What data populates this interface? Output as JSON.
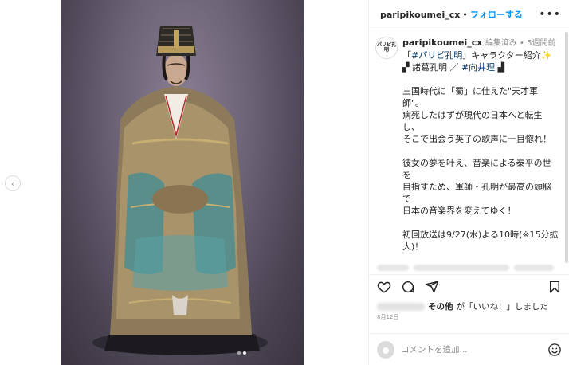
{
  "post": {
    "username": "paripikoumei_cx",
    "follow_label": "フォローする",
    "separator": "•",
    "more_label": "•••"
  },
  "caption": {
    "avatar_text": "パリピ孔明",
    "username": "paripikoumei_cx",
    "edited_label": "編集済み",
    "meta_sep": " • ",
    "time_ago": "5週間前",
    "line1_pre": "「",
    "line1_hash": "#パリピ孔明",
    "line1_post": "」キャラクター紹介✨",
    "line2_pre": "▞ 諸葛孔明 ／ ",
    "line2_hash": "#向井理",
    "line2_post": " ▟",
    "para1": [
      "三国時代に「蜀」に仕えた\"天才軍",
      "師\"。",
      "病死したはずが現代の日本へと転生",
      "し、",
      "そこで出会う英子の歌声に一目惚れ！"
    ],
    "para2": [
      "彼女の夢を叶え、音楽による泰平の世",
      "を",
      "目指すため、軍師・孔明が最高の頭脳",
      "で",
      "日本の音楽界を変えてゆく！"
    ],
    "para3": [
      "初回放送は9/27(水)よる10時(※15分拡",
      "大)！"
    ]
  },
  "likes": {
    "text_bold": "その他",
    "text_rest": "が「いいね！」しました"
  },
  "date": "8月12日",
  "comment": {
    "placeholder": "コメントを追加..."
  },
  "icons": {
    "prev": "chevron-left-icon",
    "like": "heart-icon",
    "comment": "comment-icon",
    "share": "paper-plane-icon",
    "save": "bookmark-icon",
    "emoji": "smiley-icon"
  }
}
